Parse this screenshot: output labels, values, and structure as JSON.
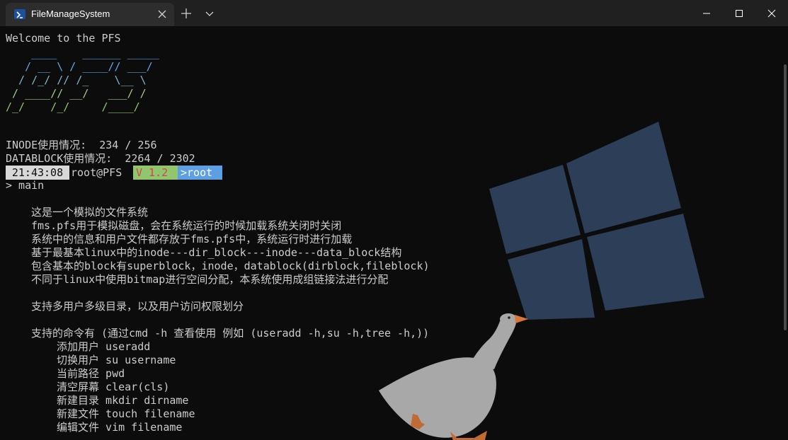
{
  "window": {
    "tab_title": "FileManageSystem",
    "icons": {
      "tab": "powershell-icon",
      "close_tab": "close-icon",
      "new_tab": "plus-icon",
      "dropdown": "chevron-down-icon",
      "minimize": "minimize-icon",
      "maximize": "maximize-icon",
      "close": "close-icon"
    }
  },
  "terminal": {
    "welcome": "Welcome to the PFS",
    "ascii_art": [
      "    ____    ______ _____",
      "   / __ \\ / ____// ___/",
      "  / /_/ // /_    \\__ \\ ",
      " / ____// __/   ___/ / ",
      "/_/    /_/     /____/  "
    ],
    "ascii_colors": [
      "#61a6e8",
      "#61a6e8",
      "#7fb6c8",
      "#a6c98c",
      "#91c56e"
    ],
    "inode_usage": "INODE使用情况:  234 / 256",
    "datablock_usage": "DATABLOCK使用情况:  2264 / 2302",
    "prompt": {
      "time": "21:43:08",
      "user": "root@PFS",
      "version": "V 1.2",
      "path": ">root"
    },
    "command": "> main",
    "description": [
      "这是一个模拟的文件系统",
      "fms.pfs用于模拟磁盘，会在系统运行的时候加载系统关闭时关闭",
      "系统中的信息和用户文件都存放于fms.pfs中，系统运行时进行加载",
      "基于最基本linux中的inode---dir_block---inode---data_block结构",
      "包含基本的block有superblock，inode，datablock(dirblock,fileblock)",
      "不同于linux中使用bitmap进行空间分配，本系统使用成组链接法进行分配"
    ],
    "multi_user": "支持多用户多级目录，以及用户访问权限划分",
    "commands_header": "支持的命令有 (通过cmd -h 查看使用 例如 (useradd -h,su -h,tree -h,))",
    "commands": [
      {
        "desc": "添加用户",
        "cmd": "useradd"
      },
      {
        "desc": "切换用户",
        "cmd": "su username"
      },
      {
        "desc": "当前路径",
        "cmd": "pwd"
      },
      {
        "desc": "清空屏幕",
        "cmd": "clear(cls)"
      },
      {
        "desc": "新建目录",
        "cmd": "mkdir dirname"
      },
      {
        "desc": "新建文件",
        "cmd": "touch filename"
      },
      {
        "desc": "编辑文件",
        "cmd": "vim filename"
      }
    ]
  },
  "colors": {
    "titlebar": "#202020",
    "tab_active": "#2d2d2d",
    "terminal_bg": "#0c0c0c",
    "text": "#cccccc",
    "windows_logo": "#2c3e58",
    "goose_body": "#a8a8a8",
    "goose_beak": "#d9773a"
  }
}
